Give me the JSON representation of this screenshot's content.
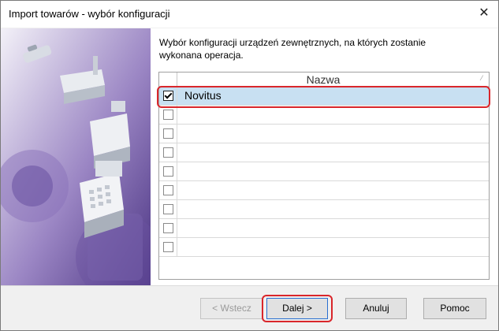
{
  "window": {
    "title": "Import towarów - wybór konfiguracji",
    "close_glyph": "✕"
  },
  "description": "Wybór konfiguracji urządzeń zewnętrznych, na których zostanie wykonana operacja.",
  "grid": {
    "column_header": "Nazwa",
    "sort_glyph": "⁄",
    "rows": [
      {
        "name": "Novitus",
        "checked": true,
        "selected": true
      },
      {
        "name": "",
        "checked": false
      },
      {
        "name": "",
        "checked": false
      },
      {
        "name": "",
        "checked": false
      },
      {
        "name": "",
        "checked": false
      },
      {
        "name": "",
        "checked": false
      },
      {
        "name": "",
        "checked": false
      },
      {
        "name": "",
        "checked": false
      },
      {
        "name": "",
        "checked": false
      }
    ]
  },
  "buttons": {
    "back": "< Wstecz",
    "next": "Dalej >",
    "cancel": "Anuluj",
    "help": "Pomoc"
  },
  "colors": {
    "banner": "#5a3f93",
    "highlight": "#d9262b",
    "selected_row": "#c8e0f2"
  },
  "icons": [
    "close-icon",
    "checkbox-icon",
    "wizard-banner-image"
  ]
}
